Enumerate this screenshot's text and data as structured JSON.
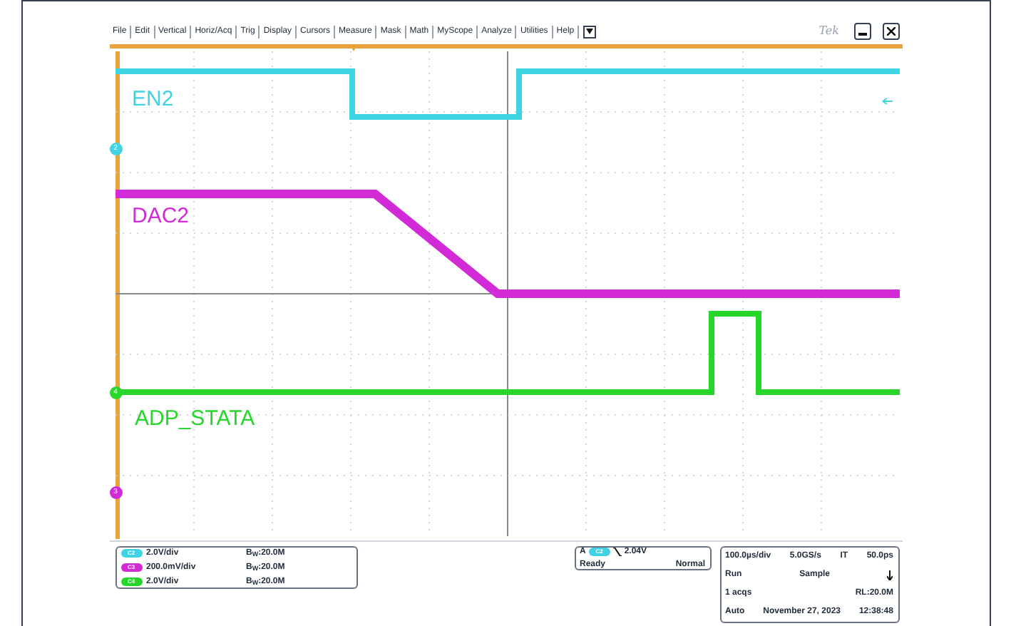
{
  "menu": [
    "File",
    "Edit",
    "Vertical",
    "Horiz/Acq",
    "Trig",
    "Display",
    "Cursors",
    "Measure",
    "Mask",
    "Math",
    "MyScope",
    "Analyze",
    "Utilities",
    "Help"
  ],
  "logo": "Tek",
  "traces": [
    {
      "label": "EN2",
      "color": "#3fd3e3"
    },
    {
      "label": "DAC2",
      "color": "#d22ad6"
    },
    {
      "label": "ADP_STATA",
      "color": "#27d62a"
    }
  ],
  "markers": [
    {
      "text": "2",
      "color": "#3fd3e3"
    },
    {
      "text": "4",
      "color": "#27d62a"
    },
    {
      "text": "3",
      "color": "#d22ad6"
    }
  ],
  "channels": [
    {
      "badge": "C2",
      "scale": "2.0V/div",
      "bandwidth": "B$_{W}$:20.0M",
      "color": "#3fd3e3"
    },
    {
      "badge": "C3",
      "scale": "200.0mV/div",
      "bandwidth": "B$_{W}$:20.0M",
      "color": "#d22ad6"
    },
    {
      "badge": "C4",
      "scale": "2.0V/div",
      "bandwidth": "B$_{W}$:20.0M",
      "color": "#27d62a"
    }
  ],
  "trigger": {
    "type": "A",
    "source": "C2",
    "level": "2.04V",
    "state": "Ready",
    "mode": "Normal"
  },
  "timebase": {
    "scale": "100.0µs/div",
    "rate": "5.0GS/s",
    "it": "IT",
    "resolution": "50.0ps",
    "run": "Run",
    "acq_mode": "Sample",
    "acqs": "1 acqs",
    "record": "RL:20.0M",
    "auto": "Auto",
    "date": "November 27, 2023",
    "time": "12:38:48"
  }
}
